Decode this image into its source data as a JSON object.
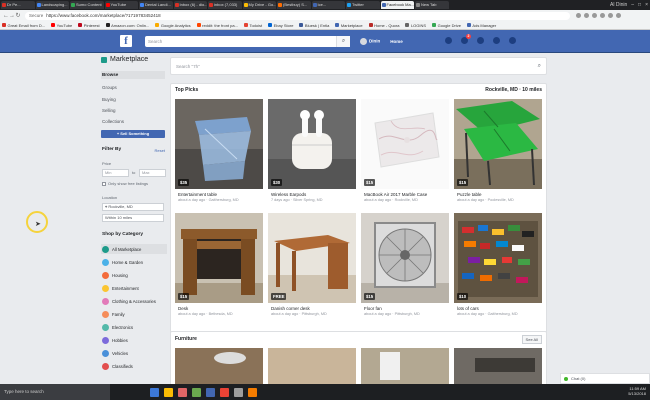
{
  "browser": {
    "tabs": [
      {
        "label": "Dr Pe...",
        "color": "#d93025",
        "active": false
      },
      {
        "label": "Landscaping...",
        "color": "#4285f4",
        "active": false
      },
      {
        "label": "Sumo Content",
        "color": "#34a853",
        "active": false
      },
      {
        "label": "YouTube",
        "color": "#ff0000",
        "active": false
      },
      {
        "label": "Dental Landi...",
        "color": "#4285f4",
        "active": false
      },
      {
        "label": "Inbox (6) - dio...",
        "color": "#d93025",
        "active": false
      },
      {
        "label": "inbox (7,033)",
        "color": "#d93025",
        "active": false
      },
      {
        "label": "My Drive - Go...",
        "color": "#fbbc04",
        "active": false
      },
      {
        "label": "(Bestbuy) S...",
        "color": "#ff6d00",
        "active": false
      },
      {
        "label": "Ice...",
        "color": "#4267b2",
        "active": false
      },
      {
        "label": "Twitter",
        "color": "#1da1f2",
        "active": false
      },
      {
        "label": "Facebook Ma...",
        "color": "#4267b2",
        "active": true
      },
      {
        "label": "New Tab",
        "color": "#888888",
        "active": false
      }
    ],
    "user_label": "Al Dinin",
    "secure_label": "Secure",
    "url": "https://www.facebook.com/marketplace/?1719783452418",
    "bookmarks": [
      {
        "label": "Great Email from D...",
        "color": "#d93025"
      },
      {
        "label": "YouTube",
        "color": "#ff0000"
      },
      {
        "label": "Pinterest",
        "color": "#bd081c"
      },
      {
        "label": "Amazon.com: Onlin...",
        "color": "#222222"
      },
      {
        "label": "Google Analytics",
        "color": "#f9ab00"
      },
      {
        "label": "reddit: the front pa...",
        "color": "#ff4500"
      },
      {
        "label": "Todoist",
        "color": "#e44332"
      },
      {
        "label": "Ebay Store",
        "color": "#0064d2"
      },
      {
        "label": "Bluesk | Entla",
        "color": "#3b5998"
      },
      {
        "label": "Marketplace",
        "color": "#4267b2"
      },
      {
        "label": "Home - Quora",
        "color": "#b92b27"
      },
      {
        "label": "LOGINS",
        "color": "#666666"
      },
      {
        "label": "Google Drive",
        "color": "#34a853"
      },
      {
        "label": "Ads Manager",
        "color": "#4267b2"
      }
    ]
  },
  "fb": {
    "logo": "f",
    "search_placeholder": "Search",
    "user": "Dinin",
    "home": "Home",
    "badge": "2"
  },
  "sidebar": {
    "title": "Marketplace",
    "nav": [
      "Browse",
      "Groups",
      "Buying",
      "Selling",
      "Collections"
    ],
    "sell_button": "+ Sell Something",
    "filter_title": "Filter By",
    "reset": "Reset",
    "price_label": "Price",
    "price_min": "Min",
    "price_to": "to",
    "price_max": "Max",
    "free_only": "Only show free listings",
    "location_label": "Location",
    "location_value": "Rockville, MD",
    "radius_value": "Within 10 miles",
    "category_title": "Shop by Category",
    "categories": [
      {
        "label": "All Marketplace",
        "color": "#1e9b8a"
      },
      {
        "label": "Home & Garden",
        "color": "#4bb1e8"
      },
      {
        "label": "Housing",
        "color": "#f36b3b"
      },
      {
        "label": "Entertainment",
        "color": "#fbc531"
      },
      {
        "label": "Clothing & Accessories",
        "color": "#e27ab9"
      },
      {
        "label": "Family",
        "color": "#f58d5b"
      },
      {
        "label": "Electronics",
        "color": "#53b9a9"
      },
      {
        "label": "Hobbies",
        "color": "#7d6bdb"
      },
      {
        "label": "Vehicles",
        "color": "#4a90d9"
      },
      {
        "label": "Classifieds",
        "color": "#e24e4e"
      }
    ]
  },
  "main": {
    "search_placeholder": "Search \"7h\"",
    "top_picks": "Top Picks",
    "location": "Rockville, MD · 10 miles",
    "items": [
      {
        "price": "$35",
        "title": "Entertainment table",
        "sub": "about a day ago · Gaithersburg, MD"
      },
      {
        "price": "$30",
        "title": "Wireless Earpods",
        "sub": "7 days ago · Silver Spring, MD"
      },
      {
        "price": "$15",
        "title": "MacBook Air 2017 Marble Case",
        "sub": "about a day ago · Rockville, MD"
      },
      {
        "price": "$15",
        "title": "Puzzle table",
        "sub": "about a day ago · Poolesville, MD"
      },
      {
        "price": "$15",
        "title": "Desk",
        "sub": "about a day ago · Bethesda, MD"
      },
      {
        "price": "FREE",
        "title": "Danish corner desk",
        "sub": "about a day ago · Pittsburgh, MD"
      },
      {
        "price": "$15",
        "title": "Floor fan",
        "sub": "about a day ago · Pittsburgh, MD"
      },
      {
        "price": "$10",
        "title": "lots of cars",
        "sub": "about a day ago · Gaithersburg, MD"
      }
    ],
    "furniture": "Furniture",
    "see_all": "See All"
  },
  "chat": {
    "label": "Chat (0)"
  },
  "taskbar": {
    "search": "Type here to search",
    "apps": [
      "#3c78d8",
      "#fbbc04",
      "#e06666",
      "#6aa84f",
      "#4267b2",
      "#ea4335",
      "#9e9e9e",
      "#f57c00"
    ],
    "time": "11:59 AM",
    "date": "5/13/2018"
  }
}
